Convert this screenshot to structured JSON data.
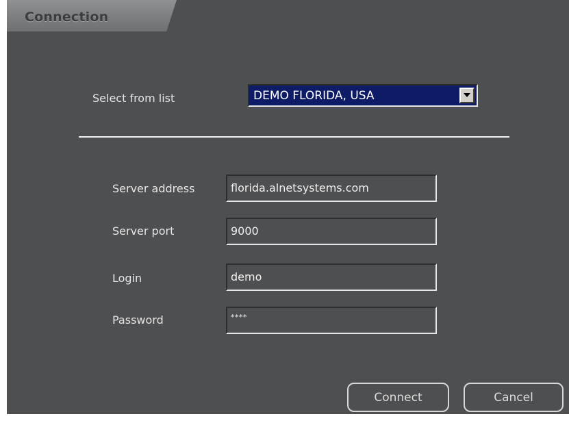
{
  "dialog": {
    "title": "Connection"
  },
  "select": {
    "label": "Select from list",
    "value": "DEMO FLORIDA, USA",
    "dropdown_icon": "chevron-down-icon"
  },
  "fields": {
    "server_address": {
      "label": "Server address",
      "value": "florida.alnetsystems.com"
    },
    "server_port": {
      "label": "Server port",
      "value": "9000"
    },
    "login": {
      "label": "Login",
      "value": "demo"
    },
    "password": {
      "label": "Password",
      "value": "****"
    }
  },
  "buttons": {
    "connect": "Connect",
    "cancel": "Cancel"
  },
  "colors": {
    "background": "#4e4f51",
    "select_background": "#0e1b66",
    "text": "#e6e6e6"
  }
}
